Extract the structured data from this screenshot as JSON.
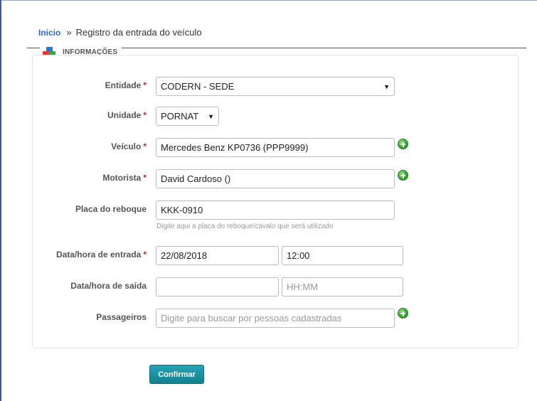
{
  "breadcrumb": {
    "home": "Inicio",
    "separator": "»",
    "current": "Registro da entrada do veículo"
  },
  "section": {
    "title": "INFORMAÇÕES",
    "icon": "blocks-icon"
  },
  "form": {
    "entidade": {
      "label": "Entidade",
      "required": "*",
      "value": "CODERN - SEDE"
    },
    "unidade": {
      "label": "Unidade",
      "required": "*",
      "value": "PORNAT"
    },
    "veiculo": {
      "label": "Veículo",
      "required": "*",
      "value": "Mercedes Benz KP0736 (PPP9999)"
    },
    "motorista": {
      "label": "Motorista",
      "required": "*",
      "value": "David Cardoso ()"
    },
    "placa_reboque": {
      "label": "Placa do reboque",
      "value": "KKK-0910",
      "help": "Digite aqui a placa do reboque/cavalo que será utilizado"
    },
    "entrada": {
      "label": "Data/hora de entrada",
      "required": "*",
      "date": "22/08/2018",
      "time": "12:00"
    },
    "saida": {
      "label": "Data/hora de saída",
      "date": "",
      "time_placeholder": "HH:MM"
    },
    "passageiros": {
      "label": "Passageiros",
      "placeholder": "Digite para buscar por pessoas cadastradas"
    }
  },
  "actions": {
    "confirm": "Confirmar"
  },
  "colors": {
    "link": "#2a68c6",
    "required": "#d02020",
    "button": "#1a93a4",
    "add": "#3aa535"
  }
}
